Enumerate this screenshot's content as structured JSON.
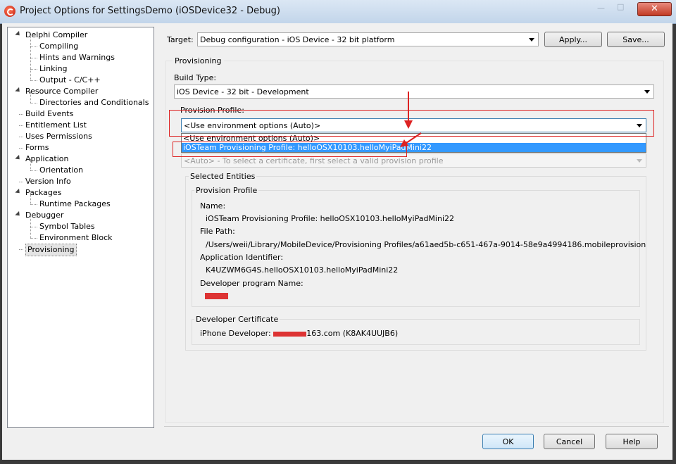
{
  "window": {
    "title": "Project Options for SettingsDemo  (iOSDevice32 - Debug)"
  },
  "tree": {
    "items": [
      {
        "label": "Delphi Compiler",
        "level": 0,
        "expand": true
      },
      {
        "label": "Compiling",
        "level": 1
      },
      {
        "label": "Hints and Warnings",
        "level": 1
      },
      {
        "label": "Linking",
        "level": 1
      },
      {
        "label": "Output - C/C++",
        "level": 1
      },
      {
        "label": "Resource Compiler",
        "level": 0,
        "expand": true
      },
      {
        "label": "Directories and Conditionals",
        "level": 1
      },
      {
        "label": "Build Events",
        "level": 0
      },
      {
        "label": "Entitlement List",
        "level": 0
      },
      {
        "label": "Uses Permissions",
        "level": 0
      },
      {
        "label": "Forms",
        "level": 0
      },
      {
        "label": "Application",
        "level": 0,
        "expand": true
      },
      {
        "label": "Orientation",
        "level": 1
      },
      {
        "label": "Version Info",
        "level": 0
      },
      {
        "label": "Packages",
        "level": 0,
        "expand": true
      },
      {
        "label": "Runtime Packages",
        "level": 1
      },
      {
        "label": "Debugger",
        "level": 0,
        "expand": true
      },
      {
        "label": "Symbol Tables",
        "level": 1
      },
      {
        "label": "Environment Block",
        "level": 1
      },
      {
        "label": "Provisioning",
        "level": 0,
        "selected": true
      }
    ]
  },
  "target": {
    "label": "Target:",
    "value": "Debug configuration - iOS Device - 32 bit platform",
    "apply_label": "Apply...",
    "save_label": "Save..."
  },
  "provisioning": {
    "section_title": "Provisioning",
    "build_type_label": "Build Type:",
    "build_type_value": "iOS Device - 32 bit - Development",
    "profile_label": "Provision Profile:",
    "profile_value": "<Use environment options (Auto)>",
    "dropdown_options": [
      "<Use environment options (Auto)>",
      "iOSTeam Provisioning Profile: helloOSX10103.helloMyiPadMini22"
    ],
    "certificate_hint": "<Auto> - To select a certificate, first select a valid provision profile",
    "selected_entities_title": "Selected Entities",
    "profile_group_title": "Provision Profile",
    "name_label": "Name:",
    "name_value": "iOSTeam Provisioning Profile: helloOSX10103.helloMyiPadMini22",
    "filepath_label": "File Path:",
    "filepath_value": "/Users/weii/Library/MobileDevice/Provisioning Profiles/a61aed5b-c651-467a-9014-58e9a4994186.mobileprovision",
    "appid_label": "Application Identifier:",
    "appid_value": "K4UZWM6G4S.helloOSX10103.helloMyiPadMini22",
    "devprog_label": "Developer program Name:",
    "cert_group_title": "Developer Certificate",
    "cert_prefix": "iPhone Developer: ",
    "cert_suffix": "163.com (K8AK4UUJB6)"
  },
  "footer": {
    "ok_label": "OK",
    "cancel_label": "Cancel",
    "help_label": "Help"
  },
  "colors": {
    "annotation": "#d22222",
    "selection": "#3399ff"
  }
}
